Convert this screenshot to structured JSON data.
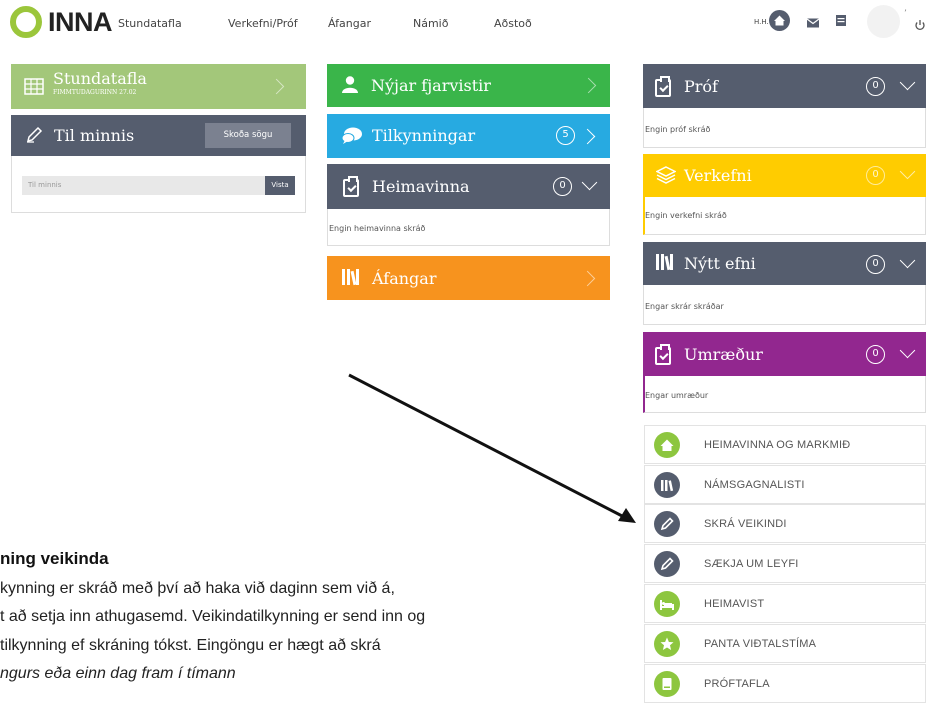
{
  "nav": {
    "logo_text": "INNA",
    "items": [
      "Stundatafla",
      "Verkefni/Próf",
      "Áfangar",
      "Námið",
      "Aðstoð"
    ],
    "user_initials": "H.H."
  },
  "left": {
    "schedule": {
      "title": "Stundatafla",
      "subtitle": "FIMMTUDAGURINN 27.02",
      "color": "#a3c77a"
    },
    "notes": {
      "title": "Til minnis",
      "history_button": "Skoða sögu",
      "input_placeholder": "Til minnis",
      "save_button": "Vista",
      "color": "#555d6e"
    }
  },
  "middle": {
    "absences": {
      "title": "Nýjar fjarvistir",
      "color": "#3ab54a"
    },
    "announcements": {
      "title": "Tilkynningar",
      "count": "5",
      "color": "#27aae1"
    },
    "homework": {
      "title": "Heimavinna",
      "count": "0",
      "empty": "Engin heimavinna skráð",
      "color": "#555d6e"
    },
    "courses": {
      "title": "Áfangar",
      "color": "#f7931e"
    }
  },
  "right": {
    "exams": {
      "title": "Próf",
      "count": "0",
      "empty": "Engin próf skráð",
      "color": "#555d6e"
    },
    "assignments": {
      "title": "Verkefni",
      "count": "0",
      "empty": "Engin verkefni skráð",
      "color": "#ffcc00"
    },
    "new_material": {
      "title": "Nýtt efni",
      "count": "0",
      "empty": "Engar skrár skráðar",
      "color": "#555d6e"
    },
    "discussions": {
      "title": "Umræður",
      "count": "0",
      "empty": "Engar umræður",
      "color": "#92278f"
    }
  },
  "quick_links": [
    {
      "label": "HEIMAVINNA OG MARKMIÐ",
      "icon": "home-icon",
      "color": "#8dc63f"
    },
    {
      "label": "NÁMSGAGNALISTI",
      "icon": "books-icon",
      "color": "#555d6e"
    },
    {
      "label": "SKRÁ VEIKINDI",
      "icon": "pen-icon",
      "color": "#555d6e"
    },
    {
      "label": "SÆKJA UM LEYFI",
      "icon": "pen-icon",
      "color": "#555d6e"
    },
    {
      "label": "HEIMAVIST",
      "icon": "bed-icon",
      "color": "#8dc63f"
    },
    {
      "label": "PANTA VIÐTALSTÍMA",
      "icon": "star-icon",
      "color": "#8dc63f"
    },
    {
      "label": "PRÓFTAFLA",
      "icon": "book-icon",
      "color": "#8dc63f"
    }
  ],
  "doc": {
    "heading": "ning veikinda",
    "lines": [
      "kynning er skráð með því að haka við daginn sem við á,",
      "t að setja inn athugasemd. Veikindatilkynning er send inn og",
      "tilkynning ef skráning tókst. Eingöngu er hægt að skrá",
      "ngurs eða einn dag fram í tímann"
    ]
  }
}
